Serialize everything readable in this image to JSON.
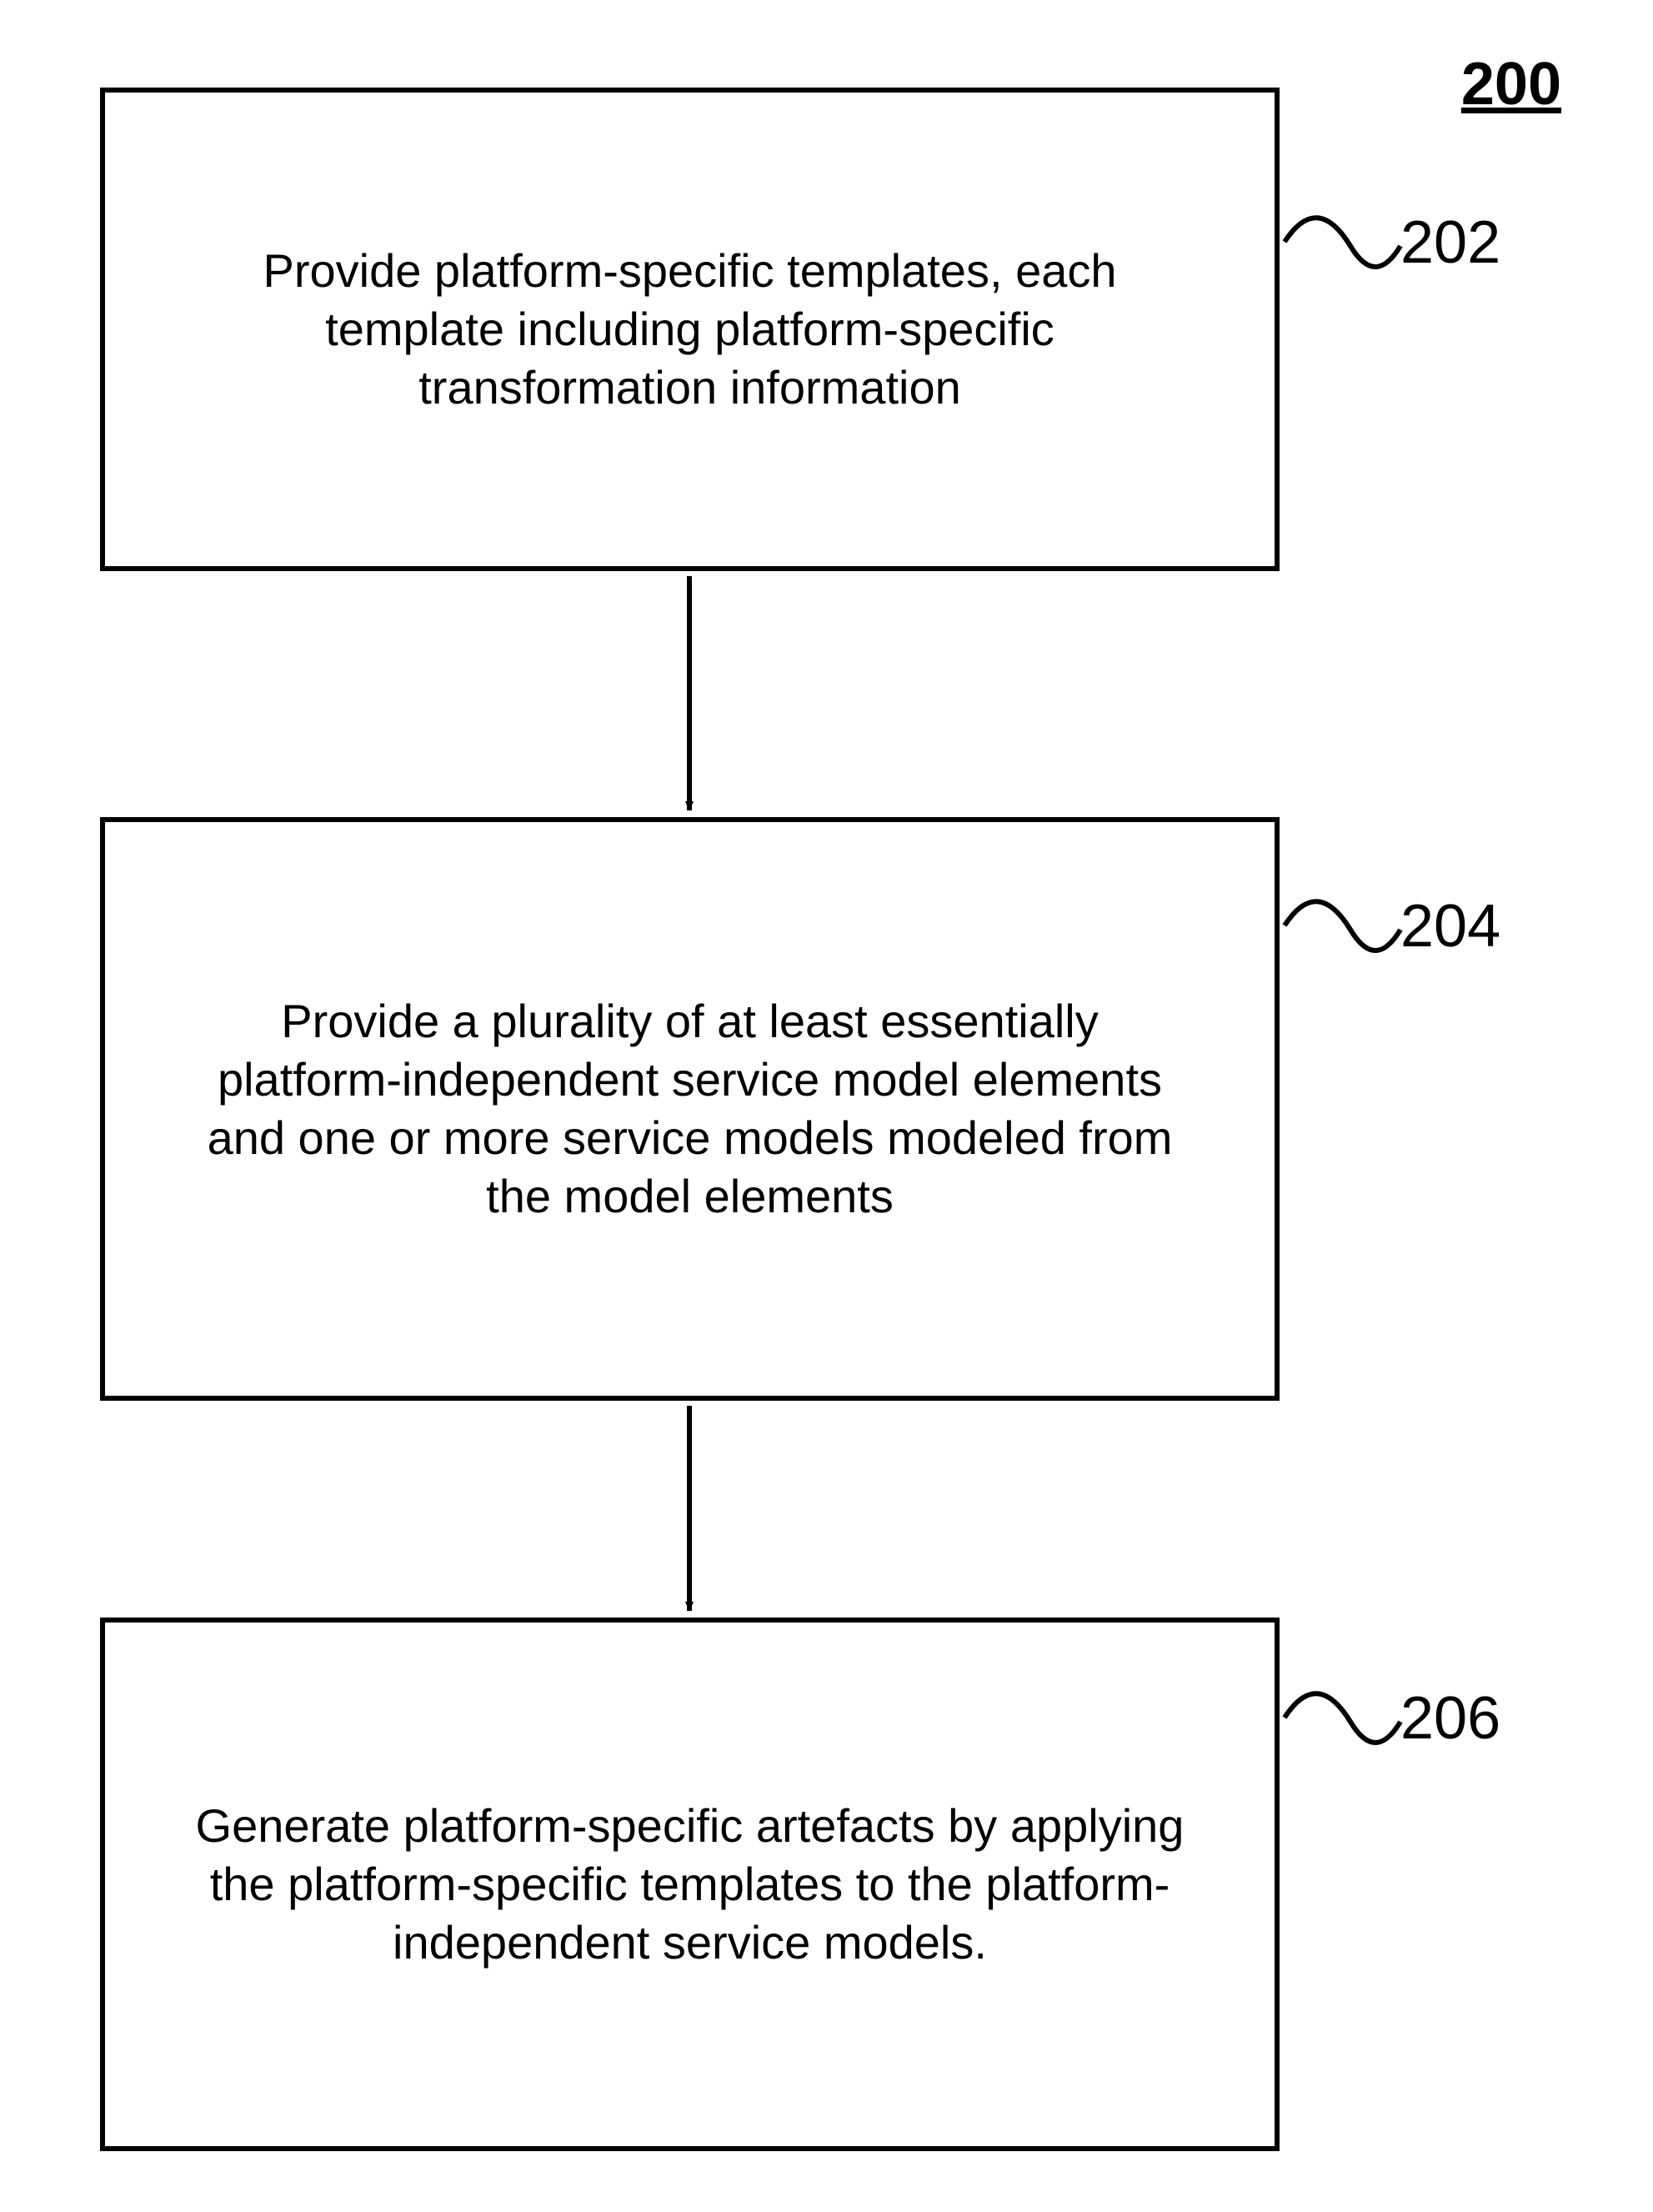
{
  "figure_label": "200",
  "steps": {
    "s1": {
      "ref": "202",
      "text": "Provide platform-specific templates, each template including platform-specific transformation information"
    },
    "s2": {
      "ref": "204",
      "text": "Provide a plurality of at least essentially platform-independent service model elements and one or more service models modeled from the model elements"
    },
    "s3": {
      "ref": "206",
      "text": "Generate platform-specific artefacts by applying the platform-specific templates to the platform-independent service models."
    }
  }
}
